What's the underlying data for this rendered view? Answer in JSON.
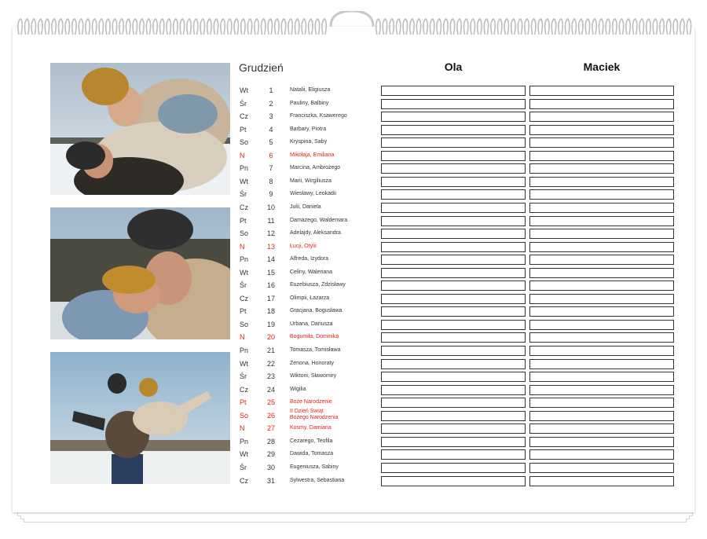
{
  "calendar": {
    "month": "Grudzień",
    "people": [
      "Ola",
      "Maciek"
    ],
    "photos": [
      {
        "name": "photo-couple-piggyback"
      },
      {
        "name": "photo-couple-embrace"
      },
      {
        "name": "photo-couple-lift"
      }
    ],
    "days": [
      {
        "dow": "Wt",
        "day": "1",
        "names": "Natalii, Eligiusza",
        "holiday": false
      },
      {
        "dow": "Śr",
        "day": "2",
        "names": "Pauliny, Balbiny",
        "holiday": false
      },
      {
        "dow": "Cz",
        "day": "3",
        "names": "Franciszka, Ksawerego",
        "holiday": false
      },
      {
        "dow": "Pt",
        "day": "4",
        "names": "Barbary, Piotra",
        "holiday": false
      },
      {
        "dow": "So",
        "day": "5",
        "names": "Kryspina, Saby",
        "holiday": false
      },
      {
        "dow": "N",
        "day": "6",
        "names": "Mikołaja, Emiliana",
        "holiday": true
      },
      {
        "dow": "Pn",
        "day": "7",
        "names": "Marcina, Ambrożego",
        "holiday": false
      },
      {
        "dow": "Wt",
        "day": "8",
        "names": "Marii, Wirgiliusza",
        "holiday": false
      },
      {
        "dow": "Śr",
        "day": "9",
        "names": "Wiesławy, Leokadii",
        "holiday": false
      },
      {
        "dow": "Cz",
        "day": "10",
        "names": "Julii, Daniela",
        "holiday": false
      },
      {
        "dow": "Pt",
        "day": "11",
        "names": "Damazego, Waldemara",
        "holiday": false
      },
      {
        "dow": "So",
        "day": "12",
        "names": "Adelajdy, Aleksandra",
        "holiday": false
      },
      {
        "dow": "N",
        "day": "13",
        "names": "Łucji, Otylii",
        "holiday": true
      },
      {
        "dow": "Pn",
        "day": "14",
        "names": "Alfreda, Izydora",
        "holiday": false
      },
      {
        "dow": "Wt",
        "day": "15",
        "names": "Celiny, Waleriana",
        "holiday": false
      },
      {
        "dow": "Śr",
        "day": "16",
        "names": "Euzebiusza, Zdzisławy",
        "holiday": false
      },
      {
        "dow": "Cz",
        "day": "17",
        "names": "Olimpii, Łazarza",
        "holiday": false
      },
      {
        "dow": "Pt",
        "day": "18",
        "names": "Gracjana, Bogusława",
        "holiday": false
      },
      {
        "dow": "So",
        "day": "19",
        "names": "Urbana, Dariusza",
        "holiday": false
      },
      {
        "dow": "N",
        "day": "20",
        "names": "Bogumiła, Dominika",
        "holiday": true
      },
      {
        "dow": "Pn",
        "day": "21",
        "names": "Tomasza, Tomisława",
        "holiday": false
      },
      {
        "dow": "Wt",
        "day": "22",
        "names": "Zenona, Honoraty",
        "holiday": false
      },
      {
        "dow": "Śr",
        "day": "23",
        "names": "Wiktorii, Sławomiry",
        "holiday": false
      },
      {
        "dow": "Cz",
        "day": "24",
        "names": "Wigilia",
        "holiday": false
      },
      {
        "dow": "Pt",
        "day": "25",
        "names": "Boże Narodzenie",
        "holiday": true
      },
      {
        "dow": "So",
        "day": "26",
        "names": "II Dzień Świąt\nBożego Narodzenia",
        "holiday": true
      },
      {
        "dow": "N",
        "day": "27",
        "names": "Kosmy, Damiana",
        "holiday": true
      },
      {
        "dow": "Pn",
        "day": "28",
        "names": "Cezarego, Teofila",
        "holiday": false
      },
      {
        "dow": "Wt",
        "day": "29",
        "names": "Dawida, Tomasza",
        "holiday": false
      },
      {
        "dow": "Śr",
        "day": "30",
        "names": "Eugeniusza, Sabiny",
        "holiday": false
      },
      {
        "dow": "Cz",
        "day": "31",
        "names": "Sylwestra, Sebastiana",
        "holiday": false
      }
    ]
  },
  "colors": {
    "holiday": "#e2231a",
    "text": "#333333",
    "box_border": "#333333"
  }
}
